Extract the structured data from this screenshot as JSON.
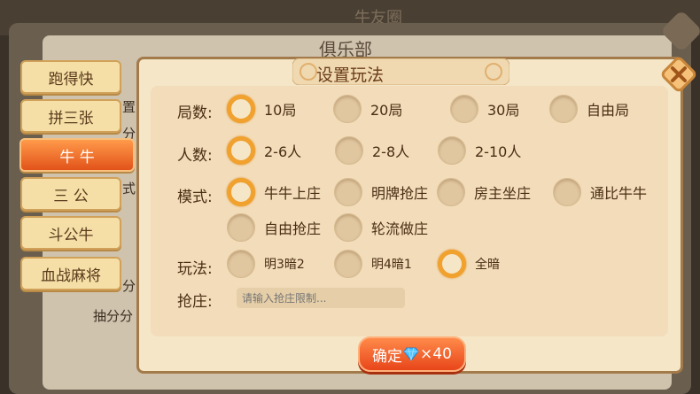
{
  "background": {
    "top_title": "牛友圈",
    "club_title": "俱乐部",
    "partial_labels": [
      "置",
      "分",
      "式",
      "分",
      "抽分分"
    ]
  },
  "tabs": [
    {
      "label": "跑得快",
      "active": false
    },
    {
      "label": "拼三张",
      "active": false
    },
    {
      "label": "牛 牛",
      "active": true
    },
    {
      "label": "三 公",
      "active": false
    },
    {
      "label": "斗公牛",
      "active": false
    },
    {
      "label": "血战麻将",
      "active": false
    }
  ],
  "dialog": {
    "title": "设置玩法",
    "rounds": {
      "label": "局数:",
      "options": [
        {
          "label": "10局",
          "selected": true
        },
        {
          "label": "20局",
          "selected": false
        },
        {
          "label": "30局",
          "selected": false
        },
        {
          "label": "自由局",
          "selected": false
        }
      ]
    },
    "players": {
      "label": "人数:",
      "options": [
        {
          "label": "2-6人",
          "selected": true
        },
        {
          "label": "2-8人",
          "selected": false
        },
        {
          "label": "2-10人",
          "selected": false
        }
      ]
    },
    "mode": {
      "label": "模式:",
      "options": [
        {
          "label": "牛牛上庄",
          "selected": true
        },
        {
          "label": "明牌抢庄",
          "selected": false
        },
        {
          "label": "房主坐庄",
          "selected": false
        },
        {
          "label": "通比牛牛",
          "selected": false
        },
        {
          "label": "自由抢庄",
          "selected": false
        },
        {
          "label": "轮流做庄",
          "selected": false
        }
      ]
    },
    "play": {
      "label": "玩法:",
      "options": [
        {
          "label": "明3暗2",
          "selected": false
        },
        {
          "label": "明4暗1",
          "selected": false
        },
        {
          "label": "全暗",
          "selected": true
        }
      ]
    },
    "banker": {
      "label": "抢庄:",
      "placeholder": "请输入抢庄限制..."
    },
    "confirm": {
      "label": "确定",
      "cost": "×40",
      "icon": "diamond-icon"
    }
  },
  "colors": {
    "accent": "#f0a12e",
    "confirm": "#e8461a",
    "panel": "#f5e6c8"
  }
}
